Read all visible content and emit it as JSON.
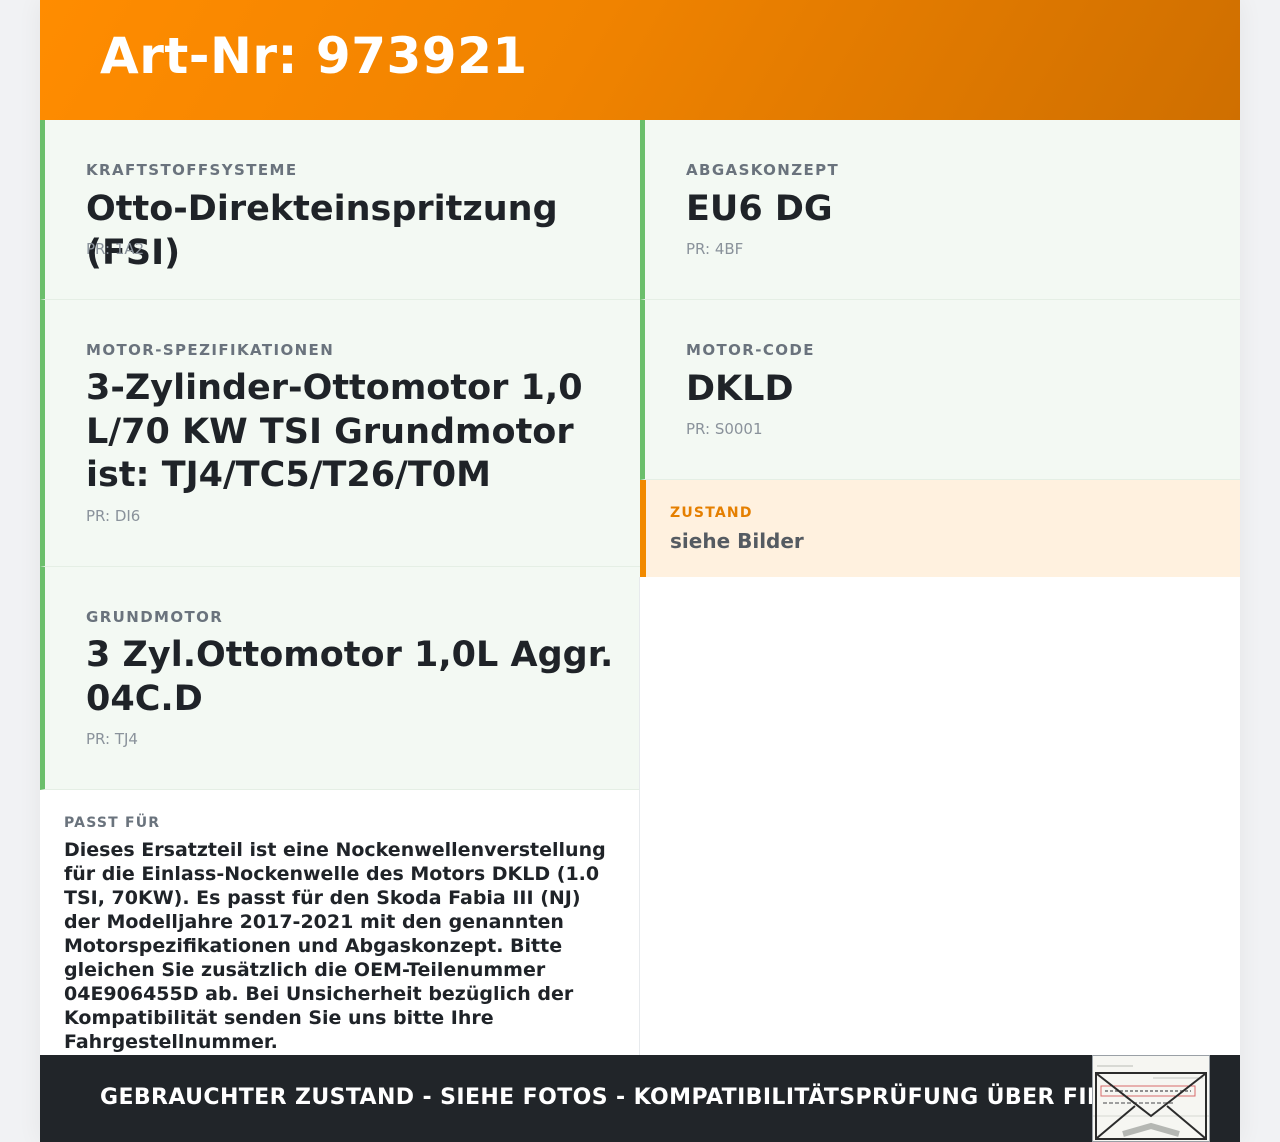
{
  "header": {
    "title": "Art-Nr: 973921"
  },
  "cards": [
    {
      "label": "KRAFTSTOFFSYSTEME",
      "value": "Otto-Direkteinspritzung (FSI)",
      "pr": "PR: 1A2"
    },
    {
      "label": "ABGASKONZEPT",
      "value": "EU6 DG",
      "pr": "PR: 4BF"
    },
    {
      "label": "MOTOR-SPEZIFIKATIONEN",
      "value": "3-Zylinder-Ottomotor 1,0 L/70 KW TSI Grundmotor ist: TJ4/TC5/T26/T0M",
      "pr": "PR: DI6"
    },
    {
      "label": "MOTOR-CODE",
      "value": "DKLD",
      "pr": "PR: S0001"
    },
    {
      "label": "GRUNDMOTOR",
      "value": "3 Zyl.Ottomotor 1,0L Aggr. 04C.D",
      "pr": "PR: TJ4"
    }
  ],
  "zustand": {
    "label": "ZUSTAND",
    "value": "siehe Bilder"
  },
  "passt": {
    "label": "PASST FÜR",
    "text": "Dieses Ersatzteil ist eine Nockenwellenverstellung für die Einlass-Nockenwelle des Motors DKLD (1.0 TSI, 70KW). Es passt für den Skoda Fabia III (NJ) der Modelljahre 2017-2021 mit den genannten Motorspezifikationen und Abgaskonzept. Bitte gleichen Sie zusätzlich die OEM-Teilenummer 04E906455D ab. Bei Unsicherheit bezüglich der Kompatibilität senden Sie uns bitte Ihre Fahrgestellnummer."
  },
  "footer": {
    "text": "GEBRAUCHTER ZUSTAND - SIEHE FOTOS - KOMPATIBILITÄTSPRÜFUNG ÜBER FIN"
  },
  "colors": {
    "header_orange": "#ff8c00",
    "card_accent_green": "#6bbf6b",
    "card_bg": "#f3f9f3",
    "zustand_accent": "#f28a00",
    "zustand_bg": "#fff1df",
    "footer_bg": "#212529"
  }
}
